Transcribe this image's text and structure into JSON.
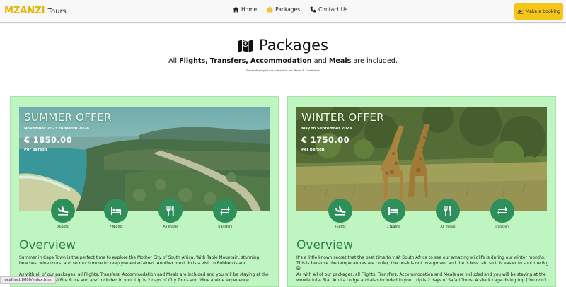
{
  "brand": {
    "mark": "MZANZI",
    "tours": "Tours"
  },
  "nav": {
    "home": "Home",
    "packages": "Packages",
    "contact": "Contact Us"
  },
  "booking_button": "Make a booking",
  "page": {
    "title": "Packages",
    "included_prefix": "All",
    "included_flights": "Flights,",
    "included_transfers": "Transfers,",
    "included_accommodation": "Accommodation",
    "included_and": "and",
    "included_meals": "Meals",
    "included_suffix": "are included.",
    "disclaimer": "Prices displayed are subject to our Terms & Conditions"
  },
  "packages": [
    {
      "offer_title": "SUMMER OFFER",
      "dates": "November 2023 to March 2024",
      "price": "€ 1850.00",
      "per": "Per person",
      "features": [
        "Flights",
        "7 Nights",
        "All meals",
        "Transfers"
      ],
      "overview_title": "Overview",
      "overview_p1": "Summer in Cape Town is the perfect time to explore the Mother City of South Africa. With Table Mountain, stunning beaches, wine tours, and so much more to keep you entertained. Another must do is a visit to Robben Island.",
      "overview_p2": "As with all of our packages, all Flights, Transfers, Accommodation and Meals are included and you will be staying at the 4 Star Protea Hotel Fire & Ice and also included in your trip is 2 days of City Tours and Wine a wine experience."
    },
    {
      "offer_title": "WINTER OFFER",
      "dates": "May to September 2024",
      "price": "€ 1750.00",
      "per": "Per person",
      "features": [
        "Flights",
        "7 Nights",
        "All meals",
        "Transfers"
      ],
      "overview_title": "Overview",
      "overview_p1": "It's a little known secret that the best time to visit South Africa to see our amazing wildlife is during our winter months. This is because the temperatures are cooler, the bush is not overgrown, and the is less rain so it is easier to spot the Big 5!",
      "overview_p2": "As with all of our packages, all Flights, Transfers, Accommodation and Meals are included and you will be staying at the wonderful 4 Star Aquila Lodge and also included in your trip is 2 days of Safari Tours. A shark cage diving trip (You don't"
    }
  ],
  "status_url": "localhost:8000/index.html",
  "colors": {
    "brand_yellow": "#e8b400",
    "booking_yellow": "#f5c518",
    "card_green": "#bff5c0",
    "icon_green": "#2f8f5b",
    "overview_green": "#2f7f50"
  },
  "icons": {
    "home": "house-icon",
    "packages": "suitcase-icon",
    "contact": "phone-icon",
    "booking": "plane-departure-icon",
    "title": "map-icon",
    "features": [
      "plane-landing-icon",
      "bed-icon",
      "utensils-icon",
      "transfer-arrows-icon"
    ]
  }
}
